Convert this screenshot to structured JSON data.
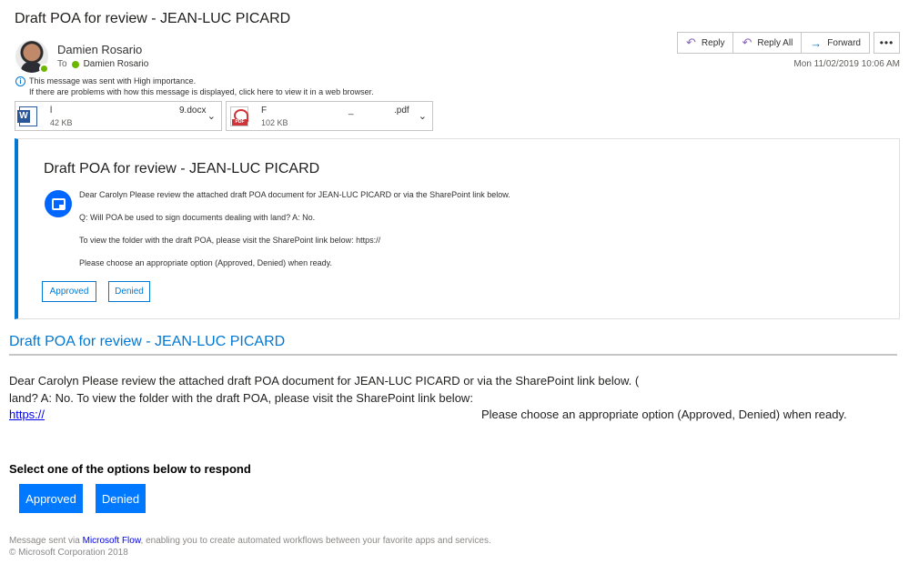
{
  "email": {
    "subject": "Draft POA for review - JEAN-LUC PICARD",
    "sender": "Damien Rosario",
    "to_label": "To",
    "recipient": "Damien Rosario",
    "date": "Mon 11/02/2019 10:06 AM",
    "importance_note": "This message was sent with High importance.",
    "display_note": "If there are problems with how this message is displayed, click here to view it in a web browser."
  },
  "actions": {
    "reply": "Reply",
    "reply_all": "Reply All",
    "forward": "Forward",
    "more": "•••"
  },
  "attachments": [
    {
      "name_start": "l",
      "name_end": "9.docx",
      "size": "42 KB",
      "icon": "word-file-icon"
    },
    {
      "name_start": "F",
      "name_mid": "_",
      "name_end": ".pdf",
      "size": "102 KB",
      "icon": "pdf-file-icon"
    }
  ],
  "card": {
    "title": "Draft POA for review - JEAN-LUC PICARD",
    "line1": "Dear Carolyn Please review the attached draft POA document for JEAN-LUC PICARD or via the SharePoint link below.",
    "line2": "Q: Will POA be used to sign documents dealing with land? A: No.",
    "line3": "To view the folder with the draft POA, please visit the SharePoint link below: https://",
    "line4": "Please choose an appropriate option (Approved, Denied) when ready.",
    "approved": "Approved",
    "denied": "Denied"
  },
  "body": {
    "heading": "Draft POA for review - JEAN-LUC PICARD",
    "para_line1": "Dear Carolyn Please review the attached draft POA document for JEAN-LUC PICARD or via the SharePoint link below. (",
    "para_line2": "land? A: No. To view the folder with the draft POA, please visit the SharePoint link below:",
    "link": "https://",
    "para_line3": "Please choose an appropriate option (Approved, Denied) when ready.",
    "prompt": "Select one of the options below to respond",
    "approved": "Approved",
    "denied": "Denied"
  },
  "footer": {
    "prefix": "Message sent via ",
    "brand": "Microsoft Flow",
    "suffix": ", enabling you to create automated workflows between your favorite apps and services.",
    "copyright": "© Microsoft Corporation 2018"
  },
  "colors": {
    "accent": "#0078d4",
    "button": "#0078ff",
    "presence": "#6bb700"
  }
}
